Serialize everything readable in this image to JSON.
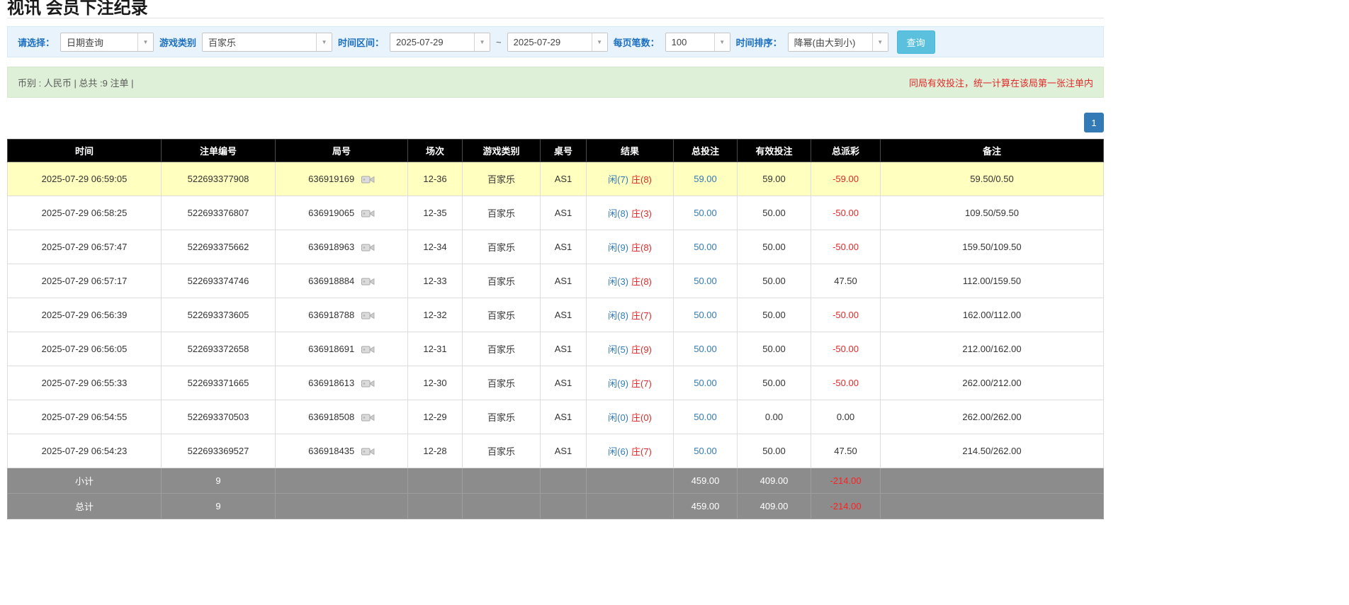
{
  "page": {
    "title": "视讯 会员下注纪录"
  },
  "filters": {
    "select_label": "请选择：",
    "select_value": "日期查询",
    "game_type_label": "游戏类别",
    "game_type_value": "百家乐",
    "time_range_label": "时间区间：",
    "date_from": "2025-07-29",
    "range_separator": "~",
    "date_to": "2025-07-29",
    "page_size_label": "每页笔数：",
    "page_size_value": "100",
    "sort_label": "时间排序：",
    "sort_value": "降幂(由大到小)",
    "search_button_label": "查询"
  },
  "icons": {
    "dropdown_arrow": "▼"
  },
  "summary": {
    "left_text": "币别 : 人民币 | 总共 :9 注单 |",
    "right_text": "同局有效投注，统一计算在该局第一张注单内"
  },
  "pagination": {
    "current_page": "1"
  },
  "colors": {
    "accent_blue": "#337ab7",
    "banker_red": "#e02a2a",
    "highlight_yellow": "#ffffbf",
    "search_button_blue": "#5bc0de",
    "header_black": "#000000",
    "summary_green": "#dff0d8",
    "filter_blue_bg": "#e8f3fb",
    "footer_gray": "#8c8c8c"
  },
  "table": {
    "headers": [
      "时间",
      "注单编号",
      "局号",
      "场次",
      "游戏类别",
      "桌号",
      "结果",
      "总投注",
      "有效投注",
      "总派彩",
      "备注"
    ],
    "rows": [
      {
        "time": "2025-07-29 06:59:05",
        "bet_id": "522693377908",
        "round_id": "636919169",
        "session": "12-36",
        "game": "百家乐",
        "table_no": "AS1",
        "player": "闲(7)",
        "banker": "庄(8)",
        "total_bet": "59.00",
        "valid_bet": "59.00",
        "payout": "-59.00",
        "note": "59.50/0.50",
        "highlighted": true
      },
      {
        "time": "2025-07-29 06:58:25",
        "bet_id": "522693376807",
        "round_id": "636919065",
        "session": "12-35",
        "game": "百家乐",
        "table_no": "AS1",
        "player": "闲(8)",
        "banker": "庄(3)",
        "total_bet": "50.00",
        "valid_bet": "50.00",
        "payout": "-50.00",
        "note": "109.50/59.50",
        "highlighted": false
      },
      {
        "time": "2025-07-29 06:57:47",
        "bet_id": "522693375662",
        "round_id": "636918963",
        "session": "12-34",
        "game": "百家乐",
        "table_no": "AS1",
        "player": "闲(9)",
        "banker": "庄(8)",
        "total_bet": "50.00",
        "valid_bet": "50.00",
        "payout": "-50.00",
        "note": "159.50/109.50",
        "highlighted": false
      },
      {
        "time": "2025-07-29 06:57:17",
        "bet_id": "522693374746",
        "round_id": "636918884",
        "session": "12-33",
        "game": "百家乐",
        "table_no": "AS1",
        "player": "闲(3)",
        "banker": "庄(8)",
        "total_bet": "50.00",
        "valid_bet": "50.00",
        "payout": "47.50",
        "note": "112.00/159.50",
        "highlighted": false
      },
      {
        "time": "2025-07-29 06:56:39",
        "bet_id": "522693373605",
        "round_id": "636918788",
        "session": "12-32",
        "game": "百家乐",
        "table_no": "AS1",
        "player": "闲(8)",
        "banker": "庄(7)",
        "total_bet": "50.00",
        "valid_bet": "50.00",
        "payout": "-50.00",
        "note": "162.00/112.00",
        "highlighted": false
      },
      {
        "time": "2025-07-29 06:56:05",
        "bet_id": "522693372658",
        "round_id": "636918691",
        "session": "12-31",
        "game": "百家乐",
        "table_no": "AS1",
        "player": "闲(5)",
        "banker": "庄(9)",
        "total_bet": "50.00",
        "valid_bet": "50.00",
        "payout": "-50.00",
        "note": "212.00/162.00",
        "highlighted": false
      },
      {
        "time": "2025-07-29 06:55:33",
        "bet_id": "522693371665",
        "round_id": "636918613",
        "session": "12-30",
        "game": "百家乐",
        "table_no": "AS1",
        "player": "闲(9)",
        "banker": "庄(7)",
        "total_bet": "50.00",
        "valid_bet": "50.00",
        "payout": "-50.00",
        "note": "262.00/212.00",
        "highlighted": false
      },
      {
        "time": "2025-07-29 06:54:55",
        "bet_id": "522693370503",
        "round_id": "636918508",
        "session": "12-29",
        "game": "百家乐",
        "table_no": "AS1",
        "player": "闲(0)",
        "banker": "庄(0)",
        "total_bet": "50.00",
        "valid_bet": "0.00",
        "payout": "0.00",
        "note": "262.00/262.00",
        "highlighted": false
      },
      {
        "time": "2025-07-29 06:54:23",
        "bet_id": "522693369527",
        "round_id": "636918435",
        "session": "12-28",
        "game": "百家乐",
        "table_no": "AS1",
        "player": "闲(6)",
        "banker": "庄(7)",
        "total_bet": "50.00",
        "valid_bet": "50.00",
        "payout": "47.50",
        "note": "214.50/262.00",
        "highlighted": false
      }
    ],
    "subtotal": {
      "label": "小计",
      "count": "9",
      "total_bet": "459.00",
      "valid_bet": "409.00",
      "payout": "-214.00"
    },
    "total": {
      "label": "总计",
      "count": "9",
      "total_bet": "459.00",
      "valid_bet": "409.00",
      "payout": "-214.00"
    }
  }
}
